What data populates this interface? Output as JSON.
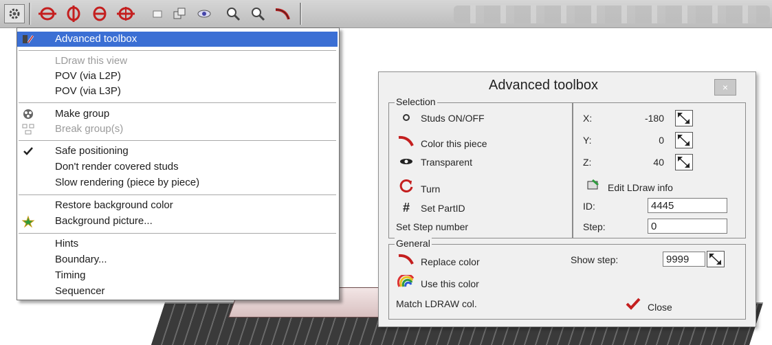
{
  "menu": {
    "items": [
      {
        "label": "Advanced toolbox",
        "icon": "toolbox-icon",
        "selected": true,
        "disabled": false
      },
      {
        "label": "LDraw this view",
        "disabled": true
      },
      {
        "label": "POV (via L2P)"
      },
      {
        "label": "POV (via L3P)"
      },
      {
        "label": "Make group",
        "icon": "group-icon"
      },
      {
        "label": "Break group(s)",
        "icon": "break-group-icon",
        "disabled": true
      },
      {
        "label": "Safe positioning",
        "checked": true
      },
      {
        "label": "Don't render covered studs"
      },
      {
        "label": "Slow rendering (piece by piece)"
      },
      {
        "label": "Restore background color"
      },
      {
        "label": "Background picture...",
        "icon": "picture-icon"
      },
      {
        "label": "Hints"
      },
      {
        "label": "Boundary..."
      },
      {
        "label": "Timing"
      },
      {
        "label": "Sequencer"
      }
    ]
  },
  "toolbox": {
    "title": "Advanced toolbox",
    "close_glyph": "×",
    "selection": {
      "label": "Selection",
      "studs": "Studs ON/OFF",
      "color_piece": "Color this piece",
      "transparent": "Transparent",
      "turn": "Turn",
      "set_partid": "Set PartID",
      "set_step": "Set Step number",
      "x_label": "X:",
      "x_value": "-180",
      "y_label": "Y:",
      "y_value": "0",
      "z_label": "Z:",
      "z_value": "40",
      "edit_ldraw": "Edit LDraw info",
      "id_label": "ID:",
      "id_value": "4445",
      "step_label": "Step:",
      "step_value": "0"
    },
    "general": {
      "label": "General",
      "replace_color": "Replace color",
      "use_color": "Use this color",
      "match_ldraw": "Match LDRAW col.",
      "show_step_label": "Show step:",
      "show_step_value": "9999",
      "close": "Close"
    }
  },
  "colors": {
    "selection_highlight": "#3b6fd4",
    "accent_red": "#c41f1f"
  }
}
